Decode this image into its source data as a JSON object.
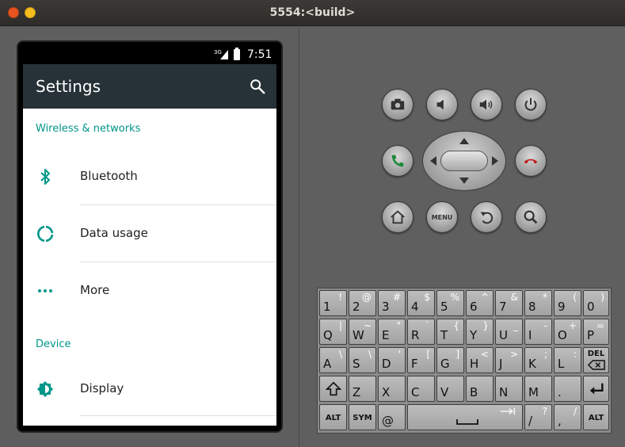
{
  "window": {
    "title": "5554:<build>"
  },
  "status_bar": {
    "network": "3G",
    "time": "7:51"
  },
  "app_bar": {
    "title": "Settings"
  },
  "sections": [
    {
      "header": "Wireless & networks",
      "items": [
        {
          "label": "Bluetooth",
          "icon": "bluetooth-icon"
        },
        {
          "label": "Data usage",
          "icon": "data-usage-icon"
        },
        {
          "label": "More",
          "icon": "more-icon"
        }
      ]
    },
    {
      "header": "Device",
      "items": [
        {
          "label": "Display",
          "icon": "display-icon"
        }
      ]
    }
  ],
  "colors": {
    "accent": "#009688",
    "appbar": "#263238",
    "text": "#212121"
  },
  "controls": {
    "menu_label": "MENU"
  },
  "keyboard": {
    "row1": [
      {
        "main": "1",
        "alt": "!"
      },
      {
        "main": "2",
        "alt": "@"
      },
      {
        "main": "3",
        "alt": "#"
      },
      {
        "main": "4",
        "alt": "$"
      },
      {
        "main": "5",
        "alt": "%"
      },
      {
        "main": "6",
        "alt": "^"
      },
      {
        "main": "7",
        "alt": "&"
      },
      {
        "main": "8",
        "alt": "*"
      },
      {
        "main": "9",
        "alt": "("
      },
      {
        "main": "0",
        "alt": ")"
      }
    ],
    "row2": [
      {
        "main": "Q",
        "alt": "|"
      },
      {
        "main": "W",
        "alt": "~"
      },
      {
        "main": "E",
        "alt": "\""
      },
      {
        "main": "R",
        "alt": "`"
      },
      {
        "main": "T",
        "alt": "{"
      },
      {
        "main": "Y",
        "alt": "}"
      },
      {
        "main": "U",
        "alt": "_"
      },
      {
        "main": "I",
        "alt": "-"
      },
      {
        "main": "O",
        "alt": "+"
      },
      {
        "main": "P",
        "alt": "="
      }
    ],
    "row3": [
      {
        "main": "A",
        "alt": "\\"
      },
      {
        "main": "S",
        "alt": "\\"
      },
      {
        "main": "D",
        "alt": "'"
      },
      {
        "main": "F",
        "alt": "["
      },
      {
        "main": "G",
        "alt": "]"
      },
      {
        "main": "H",
        "alt": "<"
      },
      {
        "main": "J",
        "alt": ">"
      },
      {
        "main": "K",
        "alt": ";"
      },
      {
        "main": "L",
        "alt": ":"
      }
    ],
    "del_label": "DEL",
    "row4": [
      {
        "main": "Z",
        "alt": ""
      },
      {
        "main": "X",
        "alt": ""
      },
      {
        "main": "C",
        "alt": ""
      },
      {
        "main": "V",
        "alt": ""
      },
      {
        "main": "B",
        "alt": ""
      },
      {
        "main": "N",
        "alt": ""
      },
      {
        "main": "M",
        "alt": ""
      },
      {
        "main": ".",
        "alt": ""
      }
    ],
    "alt_label": "ALT",
    "sym_label": "SYM",
    "at_label": "@",
    "slash": {
      "main": "/",
      "alt": "?"
    },
    "comma": {
      "main": ",",
      "alt": "/"
    }
  }
}
